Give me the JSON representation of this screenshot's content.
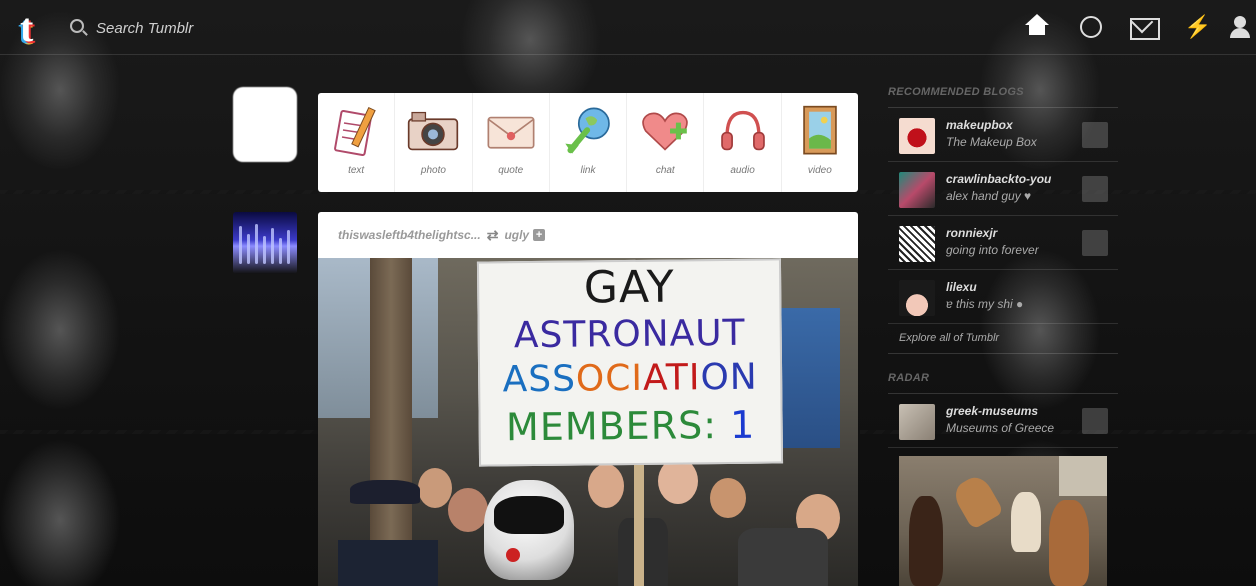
{
  "header": {
    "logo": "t",
    "search_placeholder": "Search Tumblr",
    "icons": [
      "home-icon",
      "explore-icon",
      "mail-icon",
      "lightning-icon",
      "account-icon"
    ]
  },
  "composer": {
    "types": [
      {
        "label": "text",
        "icon": "text-icon"
      },
      {
        "label": "photo",
        "icon": "camera-icon"
      },
      {
        "label": "quote",
        "icon": "quote-icon"
      },
      {
        "label": "link",
        "icon": "link-icon"
      },
      {
        "label": "chat",
        "icon": "chat-icon"
      },
      {
        "label": "audio",
        "icon": "headphones-icon"
      },
      {
        "label": "video",
        "icon": "film-icon"
      }
    ]
  },
  "post": {
    "author": "thiswasleftb4thelightsc...",
    "reblogged_from": "ugly",
    "photo": {
      "sign_lines": [
        "GAY",
        "ASTRONAUT",
        "ASSOCIATION",
        "MEMBERS: 1"
      ]
    }
  },
  "sidebar": {
    "recommended_title": "RECOMMENDED BLOGS",
    "recommended": [
      {
        "name": "makeupbox",
        "sub": "The Makeup Box"
      },
      {
        "name": "crawlinbackto-you",
        "sub": "alex hand guy ♥"
      },
      {
        "name": "ronniexjr",
        "sub": "going into forever"
      },
      {
        "name": "lilexu",
        "sub": "ɐ this my shi ●"
      }
    ],
    "explore_link": "Explore all of Tumblr",
    "radar_title": "RADAR",
    "radar": {
      "name": "greek-museums",
      "sub": "Museums of Greece"
    }
  },
  "colors": {
    "background": "#111111",
    "card": "#ffffff",
    "muted_text": "#999999"
  }
}
